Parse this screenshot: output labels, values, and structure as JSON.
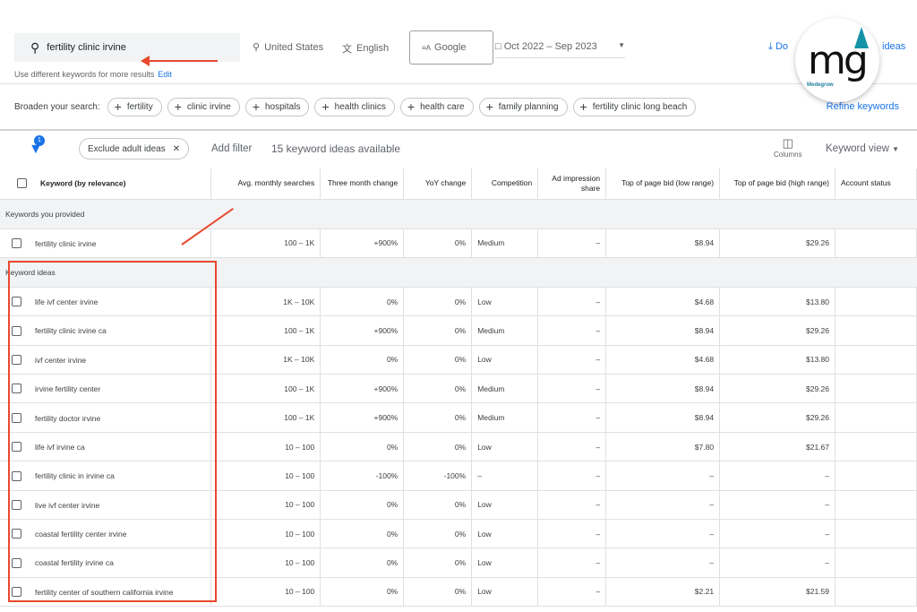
{
  "search": {
    "query": "fertility clinic irvine",
    "hint": "Use different keywords for more results",
    "edit": "Edit"
  },
  "toolbar": {
    "location": "United States",
    "language": "English",
    "network": "Google",
    "date_range": "Oct 2022 – Sep 2023",
    "download": "Do",
    "download_suffix": "ideas"
  },
  "logo": {
    "text": "mg",
    "sub": "Medegrow"
  },
  "broaden": {
    "label": "Broaden your search:",
    "chips": [
      "fertility",
      "clinic irvine",
      "hospitals",
      "health clinics",
      "health care",
      "family planning",
      "fertility clinic long beach"
    ],
    "refine": "Refine keywords"
  },
  "filters": {
    "badge": "1",
    "exclude": "Exclude adult ideas",
    "add_filter": "Add filter",
    "count": "15 keyword ideas available",
    "columns": "Columns",
    "view": "Keyword view"
  },
  "table": {
    "headers": [
      "Keyword (by relevance)",
      "Avg. monthly searches",
      "Three month change",
      "YoY change",
      "Competition",
      "Ad impression share",
      "Top of page bid (low range)",
      "Top of page bid (high range)",
      "Account status"
    ],
    "provided_label": "Keywords you provided",
    "provided": [
      [
        "fertility clinic irvine",
        "100 – 1K",
        "+900%",
        "0%",
        "Medium",
        "–",
        "$8.94",
        "$29.26",
        ""
      ]
    ],
    "ideas_label": "Keyword ideas",
    "ideas": [
      [
        "life ivf center irvine",
        "1K – 10K",
        "0%",
        "0%",
        "Low",
        "–",
        "$4.68",
        "$13.80",
        ""
      ],
      [
        "fertility clinic irvine ca",
        "100 – 1K",
        "+900%",
        "0%",
        "Medium",
        "–",
        "$8.94",
        "$29.26",
        ""
      ],
      [
        "ivf center irvine",
        "1K – 10K",
        "0%",
        "0%",
        "Low",
        "–",
        "$4.68",
        "$13.80",
        ""
      ],
      [
        "irvine fertility center",
        "100 – 1K",
        "+900%",
        "0%",
        "Medium",
        "–",
        "$8.94",
        "$29.26",
        ""
      ],
      [
        "fertility doctor irvine",
        "100 – 1K",
        "+900%",
        "0%",
        "Medium",
        "–",
        "$8.94",
        "$29.26",
        ""
      ],
      [
        "life ivf irvine ca",
        "10 – 100",
        "0%",
        "0%",
        "Low",
        "–",
        "$7.80",
        "$21.67",
        ""
      ],
      [
        "fertility clinic in irvine ca",
        "10 – 100",
        "-100%",
        "-100%",
        "–",
        "–",
        "–",
        "–",
        ""
      ],
      [
        "live ivf center irvine",
        "10 – 100",
        "0%",
        "0%",
        "Low",
        "–",
        "–",
        "–",
        ""
      ],
      [
        "coastal fertility center irvine",
        "10 – 100",
        "0%",
        "0%",
        "Low",
        "–",
        "–",
        "–",
        ""
      ],
      [
        "coastal fertility irvine ca",
        "10 – 100",
        "0%",
        "0%",
        "Low",
        "–",
        "–",
        "–",
        ""
      ],
      [
        "fertility center of southern california irvine",
        "10 – 100",
        "0%",
        "0%",
        "Low",
        "–",
        "$2.21",
        "$21.59",
        ""
      ]
    ]
  },
  "colors": {
    "accent": "#1a73e8",
    "annotation": "#e8492f"
  }
}
